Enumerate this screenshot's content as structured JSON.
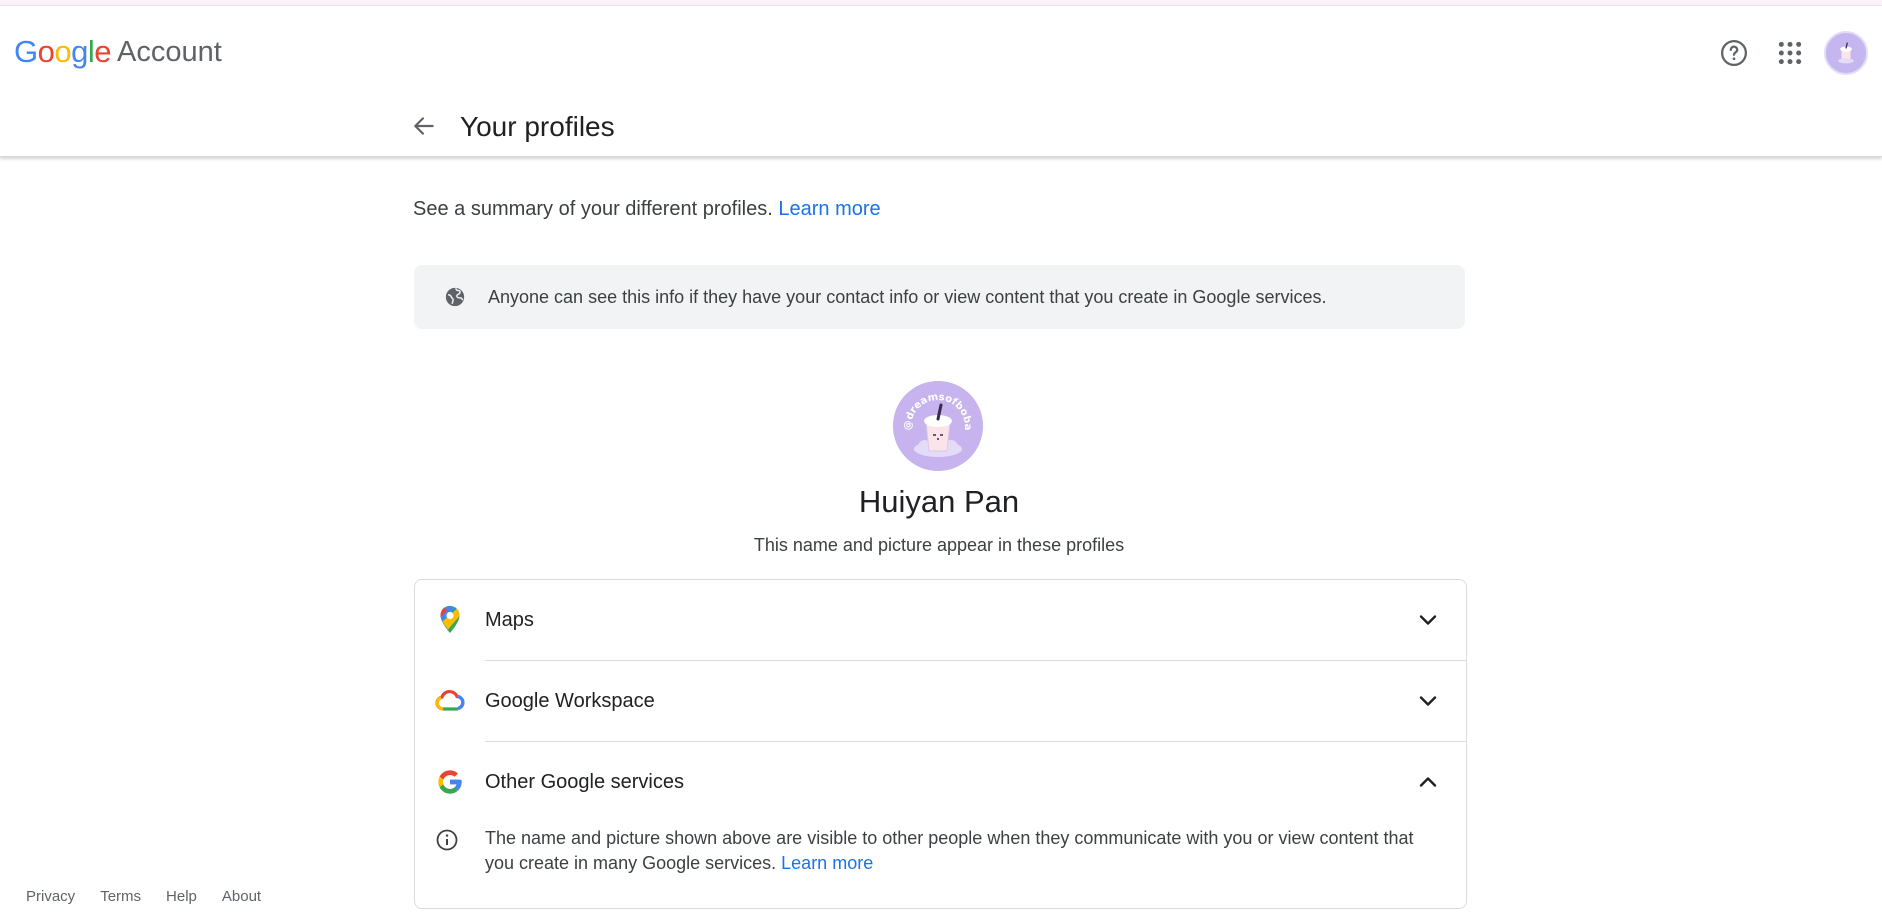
{
  "brand": {
    "logo_letters": [
      {
        "ch": "G",
        "color": "#4285f4"
      },
      {
        "ch": "o",
        "color": "#ea4335"
      },
      {
        "ch": "o",
        "color": "#fbbc05"
      },
      {
        "ch": "g",
        "color": "#4285f4"
      },
      {
        "ch": "l",
        "color": "#34a853"
      },
      {
        "ch": "e",
        "color": "#ea4335"
      }
    ],
    "account_label": "Account"
  },
  "header": {
    "icons": [
      "help-icon",
      "apps-grid-icon",
      "account-avatar"
    ],
    "back_icon": "arrow-back-icon",
    "title": "Your profiles"
  },
  "summary": {
    "text": "See a summary of your different profiles.",
    "link": "Learn more"
  },
  "notice": {
    "icon": "globe-icon",
    "text": "Anyone can see this info if they have your contact info or view content that you create in Google services."
  },
  "profile": {
    "avatar_text": "@dreamsofboba",
    "name": "Huiyan Pan",
    "subtitle": "This name and picture appear in these profiles"
  },
  "profile_rows": [
    {
      "label": "Maps",
      "icon": "maps-pin-icon",
      "expanded": false
    },
    {
      "label": "Google Workspace",
      "icon": "google-cloud-icon",
      "expanded": false
    },
    {
      "label": "Other Google services",
      "icon": "google-g-icon",
      "expanded": true
    }
  ],
  "other_services_detail": {
    "icon": "info-icon",
    "text": "The name and picture shown above are visible to other people when they communicate with you or view content that you create in many Google services.",
    "link": "Learn more"
  },
  "footer": {
    "links": [
      "Privacy",
      "Terms",
      "Help",
      "About"
    ]
  },
  "colors": {
    "link": "#1a73e8",
    "avatar_bg": "#c7b3ee",
    "notice_bg": "#f1f3f4"
  }
}
